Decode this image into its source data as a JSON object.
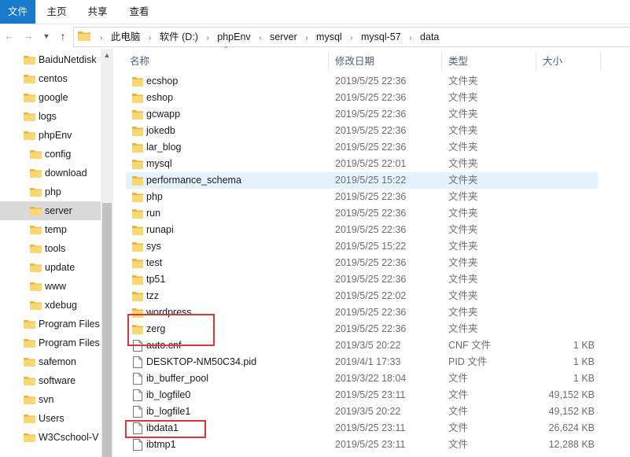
{
  "ribbon": {
    "tabs": [
      {
        "label": "文件"
      },
      {
        "label": "主页"
      },
      {
        "label": "共享"
      },
      {
        "label": "查看"
      }
    ]
  },
  "address": {
    "crumbs": [
      "此电脑",
      "软件 (D:)",
      "phpEnv",
      "server",
      "mysql",
      "mysql-57",
      "data"
    ]
  },
  "nav": {
    "items": [
      {
        "label": "BaiduNetdisk"
      },
      {
        "label": "centos"
      },
      {
        "label": "google"
      },
      {
        "label": "logs"
      },
      {
        "label": "phpEnv"
      },
      {
        "label": "config"
      },
      {
        "label": "download"
      },
      {
        "label": "php"
      },
      {
        "label": "server"
      },
      {
        "label": "temp"
      },
      {
        "label": "tools"
      },
      {
        "label": "update"
      },
      {
        "label": "www"
      },
      {
        "label": "xdebug"
      },
      {
        "label": "Program Files"
      },
      {
        "label": "Program Files"
      },
      {
        "label": "safemon"
      },
      {
        "label": "software"
      },
      {
        "label": "svn"
      },
      {
        "label": "Users"
      },
      {
        "label": "W3Cschool-V"
      }
    ]
  },
  "columns": {
    "name": "名称",
    "date": "修改日期",
    "type": "类型",
    "size": "大小"
  },
  "files": [
    {
      "name": "ecshop",
      "date": "2019/5/25 22:36",
      "type": "文件夹",
      "size": ""
    },
    {
      "name": "eshop",
      "date": "2019/5/25 22:36",
      "type": "文件夹",
      "size": ""
    },
    {
      "name": "gcwapp",
      "date": "2019/5/25 22:36",
      "type": "文件夹",
      "size": ""
    },
    {
      "name": "jokedb",
      "date": "2019/5/25 22:36",
      "type": "文件夹",
      "size": ""
    },
    {
      "name": "lar_blog",
      "date": "2019/5/25 22:36",
      "type": "文件夹",
      "size": ""
    },
    {
      "name": "mysql",
      "date": "2019/5/25 22:01",
      "type": "文件夹",
      "size": ""
    },
    {
      "name": "performance_schema",
      "date": "2019/5/25 15:22",
      "type": "文件夹",
      "size": ""
    },
    {
      "name": "php",
      "date": "2019/5/25 22:36",
      "type": "文件夹",
      "size": ""
    },
    {
      "name": "run",
      "date": "2019/5/25 22:36",
      "type": "文件夹",
      "size": ""
    },
    {
      "name": "runapi",
      "date": "2019/5/25 22:36",
      "type": "文件夹",
      "size": ""
    },
    {
      "name": "sys",
      "date": "2019/5/25 15:22",
      "type": "文件夹",
      "size": ""
    },
    {
      "name": "test",
      "date": "2019/5/25 22:36",
      "type": "文件夹",
      "size": ""
    },
    {
      "name": "tp51",
      "date": "2019/5/25 22:36",
      "type": "文件夹",
      "size": ""
    },
    {
      "name": "tzz",
      "date": "2019/5/25 22:02",
      "type": "文件夹",
      "size": ""
    },
    {
      "name": "wordpress",
      "date": "2019/5/25 22:36",
      "type": "文件夹",
      "size": ""
    },
    {
      "name": "zerg",
      "date": "2019/5/25 22:36",
      "type": "文件夹",
      "size": ""
    },
    {
      "name": "auto.cnf",
      "date": "2019/3/5 20:22",
      "type": "CNF 文件",
      "size": "1 KB"
    },
    {
      "name": "DESKTOP-NM50C34.pid",
      "date": "2019/4/1 17:33",
      "type": "PID 文件",
      "size": "1 KB"
    },
    {
      "name": "ib_buffer_pool",
      "date": "2019/3/22 18:04",
      "type": "文件",
      "size": "1 KB"
    },
    {
      "name": "ib_logfile0",
      "date": "2019/5/25 23:11",
      "type": "文件",
      "size": "49,152 KB"
    },
    {
      "name": "ib_logfile1",
      "date": "2019/3/5 20:22",
      "type": "文件",
      "size": "49,152 KB"
    },
    {
      "name": "ibdata1",
      "date": "2019/5/25 23:11",
      "type": "文件",
      "size": "26,624 KB"
    },
    {
      "name": "ibtmp1",
      "date": "2019/5/25 23:11",
      "type": "文件",
      "size": "12,288 KB"
    }
  ],
  "colors": {
    "accent": "#1979ca",
    "folder": "#e9b53f",
    "highlight": "#d9363e",
    "hover_row": "#e5f3ff",
    "selected_nav": "#d9d9d9"
  }
}
